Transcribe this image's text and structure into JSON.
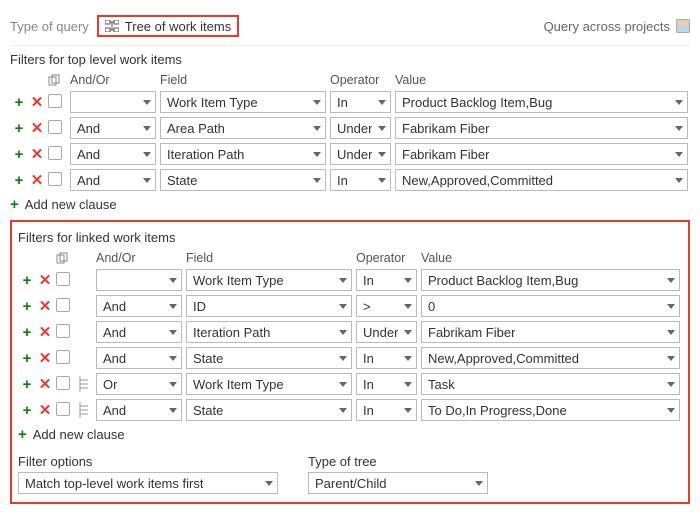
{
  "labels": {
    "type_of_query": "Type of query",
    "query_type": "Tree of work items",
    "query_across_projects": "Query across projects",
    "filters_top": "Filters for top level work items",
    "filters_linked": "Filters for linked work items",
    "add_clause": "Add new clause",
    "filter_options": "Filter options",
    "filter_options_value": "Match top-level work items first",
    "type_of_tree": "Type of tree",
    "type_of_tree_value": "Parent/Child",
    "headers": {
      "and_or": "And/Or",
      "field": "Field",
      "operator": "Operator",
      "value": "Value"
    }
  },
  "top": {
    "rows": [
      {
        "and_or": "",
        "and_or_empty": true,
        "field": "Work Item Type",
        "op": "In",
        "val": "Product Backlog Item,Bug"
      },
      {
        "and_or": "And",
        "and_or_empty": false,
        "field": "Area Path",
        "op": "Under",
        "val": "Fabrikam Fiber"
      },
      {
        "and_or": "And",
        "and_or_empty": false,
        "field": "Iteration Path",
        "op": "Under",
        "val": "Fabrikam Fiber"
      },
      {
        "and_or": "And",
        "and_or_empty": false,
        "field": "State",
        "op": "In",
        "val": "New,Approved,Committed"
      }
    ]
  },
  "linked": {
    "rows": [
      {
        "indent": false,
        "and_or": "",
        "and_or_empty": true,
        "field": "Work Item Type",
        "op": "In",
        "val": "Product Backlog Item,Bug"
      },
      {
        "indent": false,
        "and_or": "And",
        "and_or_empty": false,
        "field": "ID",
        "op": ">",
        "val": "0"
      },
      {
        "indent": false,
        "and_or": "And",
        "and_or_empty": false,
        "field": "Iteration Path",
        "op": "Under",
        "val": "Fabrikam Fiber"
      },
      {
        "indent": false,
        "and_or": "And",
        "and_or_empty": false,
        "field": "State",
        "op": "In",
        "val": "New,Approved,Committed"
      },
      {
        "indent": true,
        "and_or": "Or",
        "and_or_empty": false,
        "field": "Work Item Type",
        "op": "In",
        "val": "Task"
      },
      {
        "indent": true,
        "and_or": "And",
        "and_or_empty": false,
        "field": "State",
        "op": "In",
        "val": "To Do,In Progress,Done"
      }
    ]
  }
}
